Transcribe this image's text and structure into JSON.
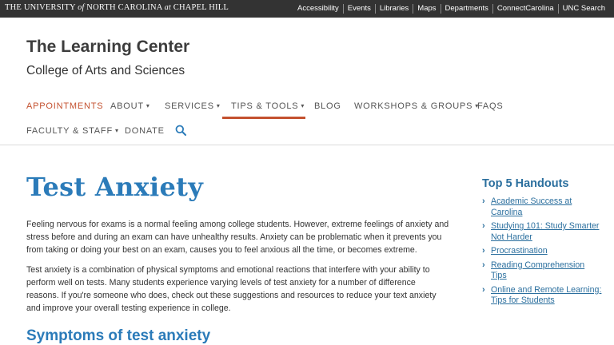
{
  "topbar": {
    "brand_the": "THE",
    "brand_university": "UNIVERSITY",
    "brand_of": "of",
    "brand_nc": "NORTH CAROLINA",
    "brand_at": "at",
    "brand_ch": "CHAPEL HILL",
    "links": [
      "Accessibility",
      "Events",
      "Libraries",
      "Maps",
      "Departments",
      "ConnectCarolina",
      "UNC Search"
    ]
  },
  "header": {
    "title": "The Learning Center",
    "subtitle": "College of Arts and Sciences"
  },
  "nav": {
    "items": [
      {
        "label": "APPOINTMENTS",
        "caret": ""
      },
      {
        "label": "ABOUT",
        "caret": "▾"
      },
      {
        "label": "SERVICES",
        "caret": "▾"
      },
      {
        "label": "TIPS & TOOLS",
        "caret": "▾"
      },
      {
        "label": "BLOG",
        "caret": ""
      },
      {
        "label": "WORKSHOPS & GROUPS",
        "caret": "▾"
      },
      {
        "label": "FAQS",
        "caret": ""
      },
      {
        "label": "FACULTY & STAFF",
        "caret": "▾"
      },
      {
        "label": "DONATE",
        "caret": ""
      }
    ],
    "search_icon": "search-icon",
    "accent_color": "#c4512f"
  },
  "main": {
    "title": "Test Anxiety",
    "paragraph1": "Feeling nervous for exams is a normal feeling among college students. However, extreme feelings of anxiety and stress before and during an exam can have unhealthy results. Anxiety can be problematic when it prevents you from taking or doing your best on an exam, causes you to feel anxious all the time, or becomes extreme.",
    "paragraph2": "Test anxiety is a combination of physical symptoms and emotional reactions that interfere with your ability to perform well on tests. Many students experience varying levels of test anxiety for a number of difference reasons. If you're someone who does, check out these suggestions and resources to reduce your text anxiety and improve your overall testing experience in college.",
    "section_heading": "Symptoms of test anxiety",
    "title_color": "#2b7bb9"
  },
  "sidebar": {
    "title": "Top 5 Handouts",
    "handouts": [
      "Academic Success at Carolina",
      "Studying 101: Study Smarter Not Harder",
      "Procrastination",
      "Reading Comprehension Tips",
      "Online and Remote Learning: Tips for Students"
    ]
  }
}
